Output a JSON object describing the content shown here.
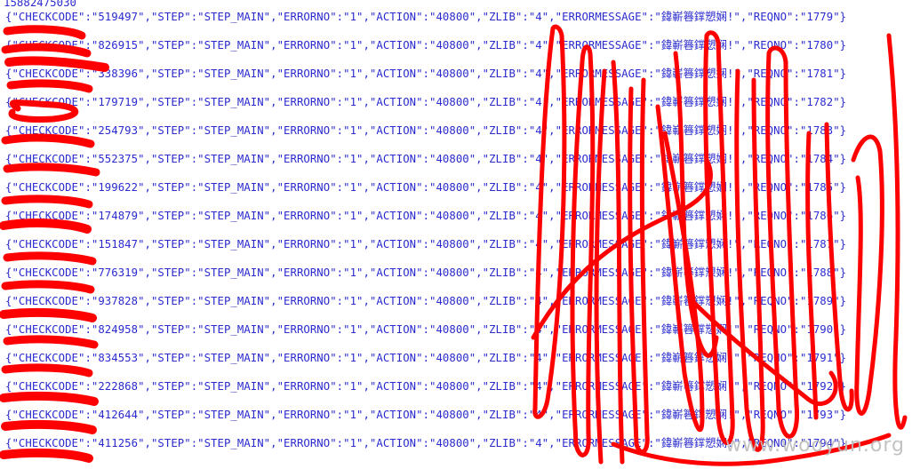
{
  "log": {
    "header_line": "15882475030",
    "lines": [
      "{\"CHECKCODE\":\"519497\",\"STEP\":\"STEP_MAIN\",\"ERRORNO\":\"1\",\"ACTION\":\"40800\",\"ZLIB\":\"4\",\"ERRORMESSAGE\":\"鍏嶄簭鐣愬娴!\",\"REQNO\":\"1779\"}",
      "{\"CHECKCODE\":\"826915\",\"STEP\":\"STEP_MAIN\",\"ERRORNO\":\"1\",\"ACTION\":\"40800\",\"ZLIB\":\"4\",\"ERRORMESSAGE\":\"鍏嶄簭鐣愬娴!\",\"REQNO\":\"1780\"}",
      "{\"CHECKCODE\":\"338396\",\"STEP\":\"STEP_MAIN\",\"ERRORNO\":\"1\",\"ACTION\":\"40800\",\"ZLIB\":\"4\",\"ERRORMESSAGE\":\"鍏嶄簭鐣愬娴!\",\"REQNO\":\"1781\"}",
      "{\"CHECKCODE\":\"179719\",\"STEP\":\"STEP_MAIN\",\"ERRORNO\":\"1\",\"ACTION\":\"40800\",\"ZLIB\":\"4\",\"ERRORMESSAGE\":\"鍏嶄簭鐣愬娴!\",\"REQNO\":\"1782\"}",
      "{\"CHECKCODE\":\"254793\",\"STEP\":\"STEP_MAIN\",\"ERRORNO\":\"1\",\"ACTION\":\"40800\",\"ZLIB\":\"4\",\"ERRORMESSAGE\":\"鍏嶄簭鐣愬娴!\",\"REQNO\":\"1783\"}",
      "{\"CHECKCODE\":\"552375\",\"STEP\":\"STEP_MAIN\",\"ERRORNO\":\"1\",\"ACTION\":\"40800\",\"ZLIB\":\"4\",\"ERRORMESSAGE\":\"鍏嶄簭鐣愬娴!\",\"REQNO\":\"1784\"}",
      "{\"CHECKCODE\":\"199622\",\"STEP\":\"STEP_MAIN\",\"ERRORNO\":\"1\",\"ACTION\":\"40800\",\"ZLIB\":\"4\",\"ERRORMESSAGE\":\"鍏嶄簭鐣愬娴!\",\"REQNO\":\"1785\"}",
      "{\"CHECKCODE\":\"174879\",\"STEP\":\"STEP_MAIN\",\"ERRORNO\":\"1\",\"ACTION\":\"40800\",\"ZLIB\":\"4\",\"ERRORMESSAGE\":\"鍏嶄簭鐣愬娴!\",\"REQNO\":\"1786\"}",
      "{\"CHECKCODE\":\"151847\",\"STEP\":\"STEP_MAIN\",\"ERRORNO\":\"1\",\"ACTION\":\"40800\",\"ZLIB\":\"4\",\"ERRORMESSAGE\":\"鍏嶄簭鐣愬娴!\",\"REQNO\":\"1787\"}",
      "{\"CHECKCODE\":\"776319\",\"STEP\":\"STEP_MAIN\",\"ERRORNO\":\"1\",\"ACTION\":\"40800\",\"ZLIB\":\"4\",\"ERRORMESSAGE\":\"鍏嶄簭鐣愬娴!\",\"REQNO\":\"1788\"}",
      "{\"CHECKCODE\":\"937828\",\"STEP\":\"STEP_MAIN\",\"ERRORNO\":\"1\",\"ACTION\":\"40800\",\"ZLIB\":\"4\",\"ERRORMESSAGE\":\"鍏嶄簭鐣愬娴!\",\"REQNO\":\"1789\"}",
      "{\"CHECKCODE\":\"824958\",\"STEP\":\"STEP_MAIN\",\"ERRORNO\":\"1\",\"ACTION\":\"40800\",\"ZLIB\":\"4\",\"ERRORMESSAGE\":\"鍏嶄簭鐣愬娴!\",\"REQNO\":\"1790\"}",
      "{\"CHECKCODE\":\"834553\",\"STEP\":\"STEP_MAIN\",\"ERRORNO\":\"1\",\"ACTION\":\"40800\",\"ZLIB\":\"4\",\"ERRORMESSAGE\":\"鍏嶄簭鐣愬娴!\",\"REQNO\":\"1791\"}",
      "{\"CHECKCODE\":\"222868\",\"STEP\":\"STEP_MAIN\",\"ERRORNO\":\"1\",\"ACTION\":\"40800\",\"ZLIB\":\"4\",\"ERRORMESSAGE\":\"鍏嶄簭鐣愬娴!\",\"REQNO\":\"1792\"}",
      "{\"CHECKCODE\":\"412644\",\"STEP\":\"STEP_MAIN\",\"ERRORNO\":\"1\",\"ACTION\":\"40800\",\"ZLIB\":\"4\",\"ERRORMESSAGE\":\"鍏嶄簭鐣愬娴!\",\"REQNO\":\"1793\"}",
      "{\"CHECKCODE\":\"411256\",\"STEP\":\"STEP_MAIN\",\"ERRORNO\":\"1\",\"ACTION\":\"40800\",\"ZLIB\":\"4\",\"ERRORMESSAGE\":\"鍏嶄簭鐣愬娴!\",\"REQNO\":\"1794\"}"
    ]
  },
  "watermark": "www.wooyun.org",
  "colors": {
    "text": "#2b2bd0",
    "redaction": "#ff0000",
    "background": "#ffffff"
  }
}
